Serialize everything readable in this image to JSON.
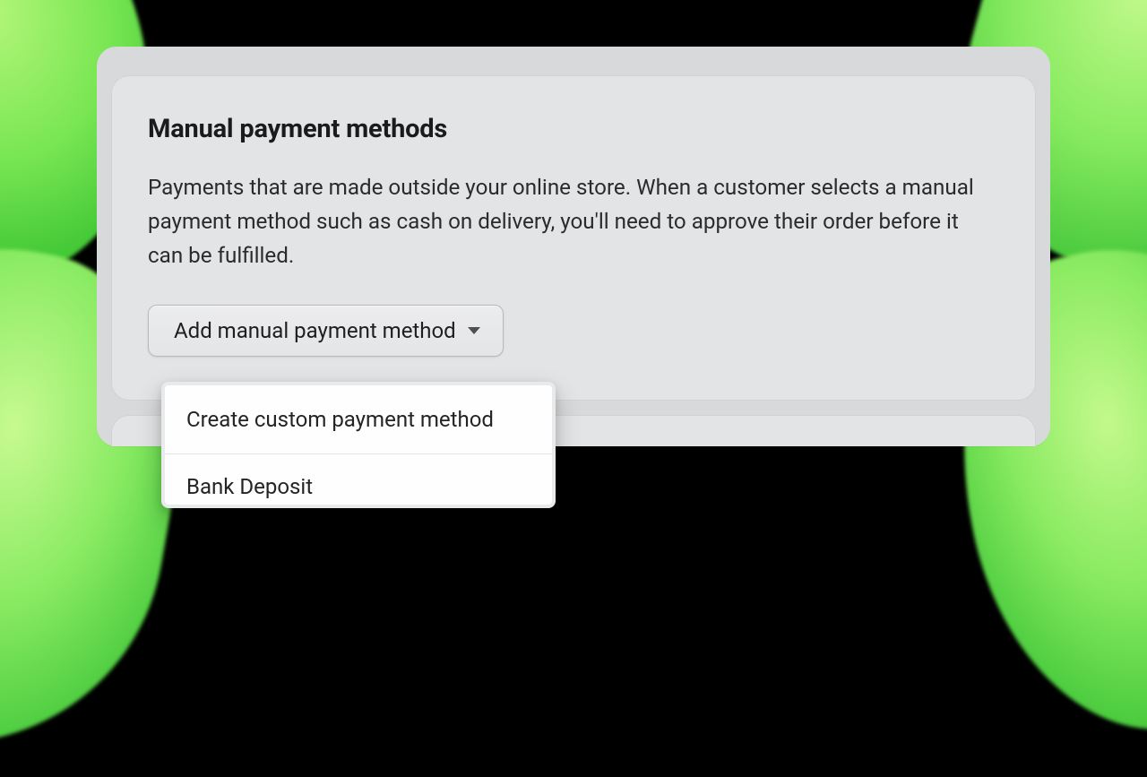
{
  "card": {
    "title": "Manual payment methods",
    "description": "Payments that are made outside your online store. When a customer selects a manual payment method such as cash on delivery, you'll need to approve their order before it can be fulfilled.",
    "dropdown_label": "Add manual payment method"
  },
  "menu": {
    "items": [
      "Create custom payment method",
      "Bank Deposit"
    ]
  }
}
